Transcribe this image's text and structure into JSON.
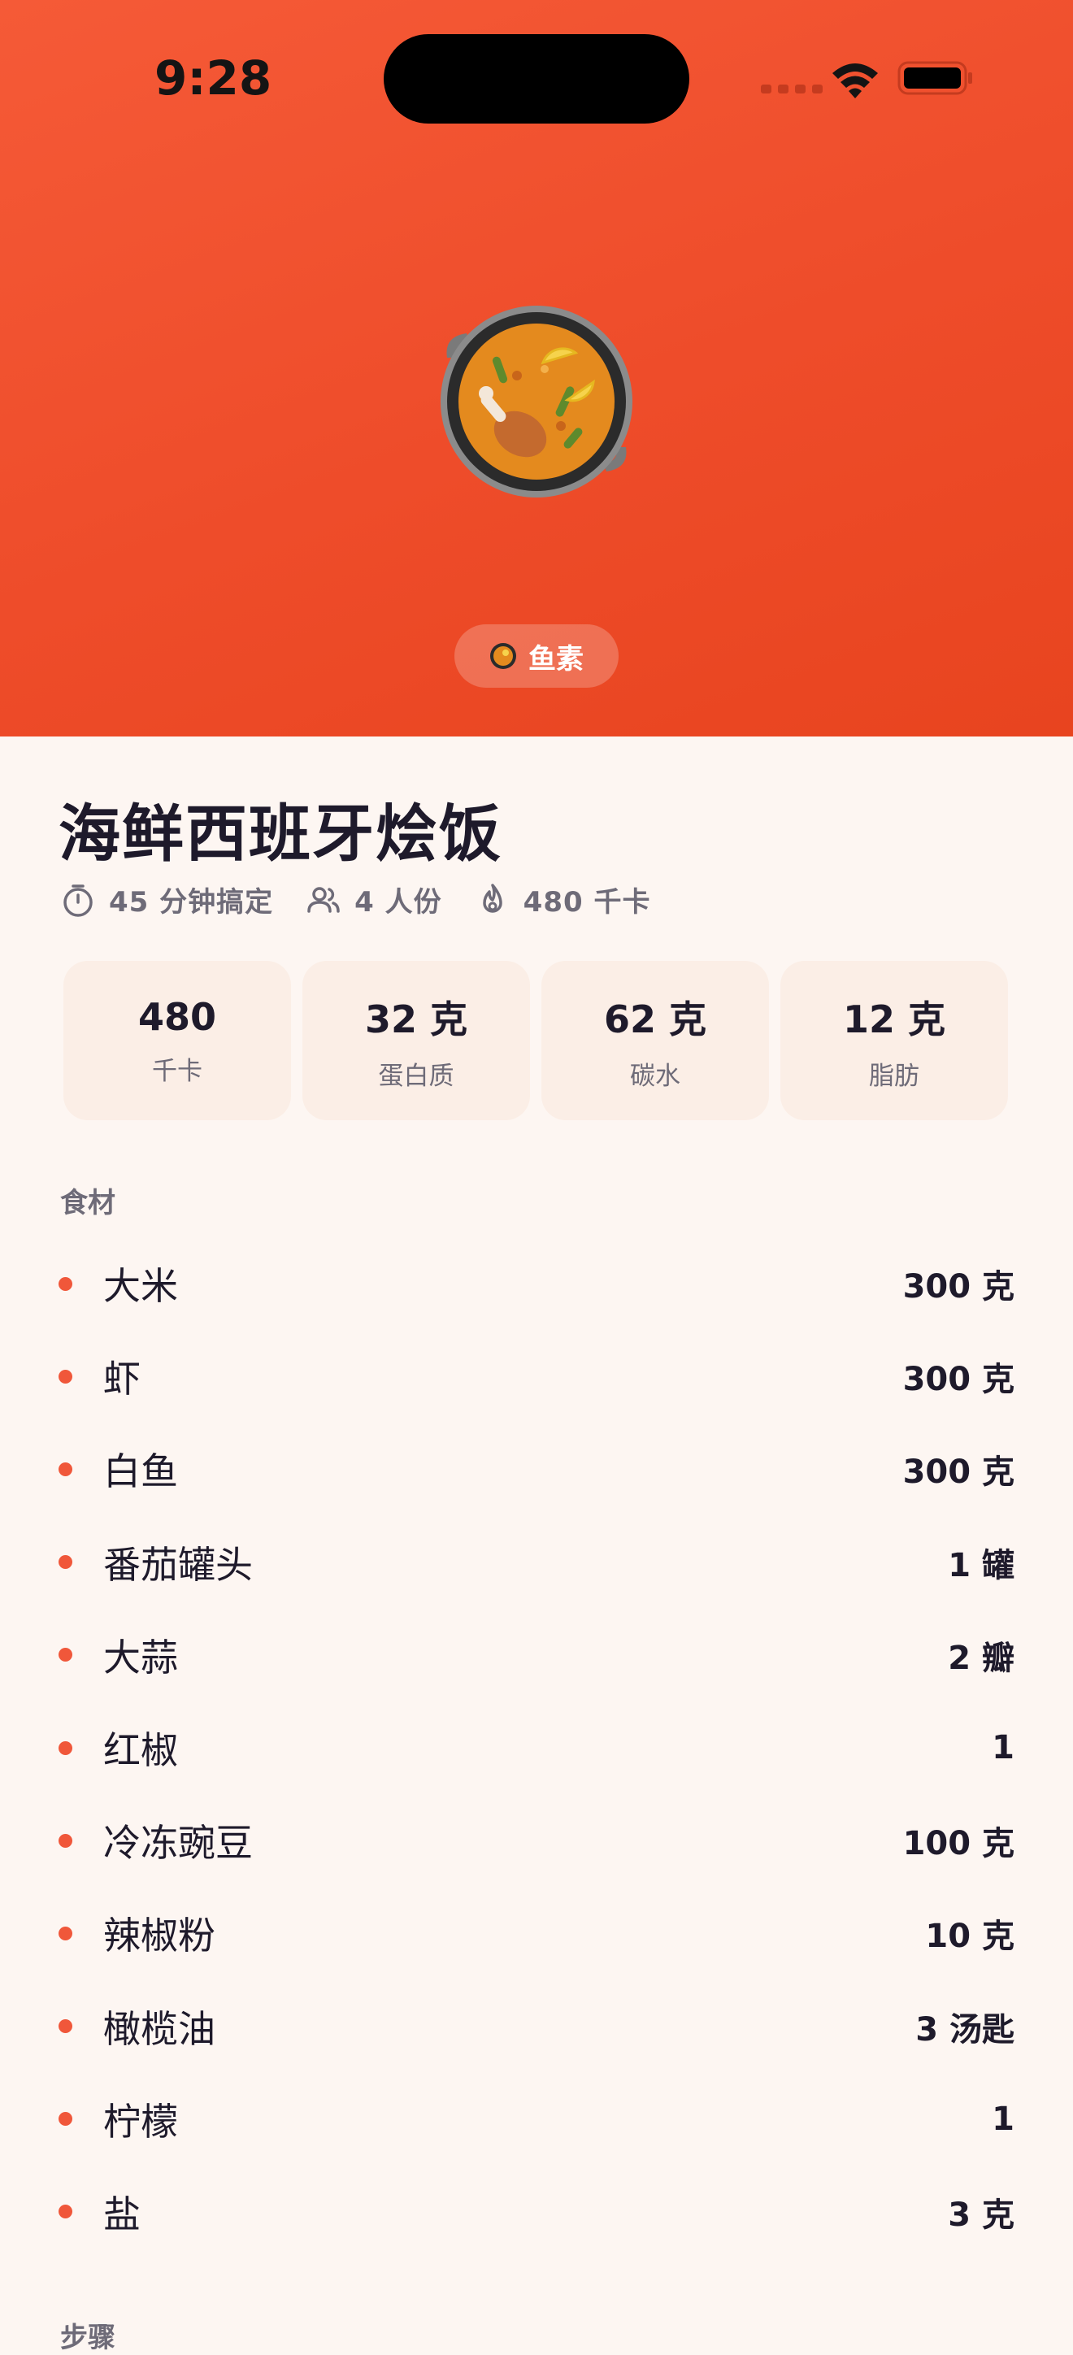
{
  "status_bar": {
    "time": "9:28"
  },
  "hero": {
    "dish_icon": "paella-emoji",
    "tag": {
      "icon": "paella-emoji",
      "label": "鱼素"
    },
    "colors": {
      "gradient_start": "#F55A37",
      "gradient_end": "#E8441F"
    }
  },
  "recipe": {
    "title": "海鲜西班牙烩饭",
    "meta": [
      {
        "icon": "timer-icon",
        "text": "45 分钟搞定"
      },
      {
        "icon": "people-icon",
        "text": "4 人份"
      },
      {
        "icon": "flame-icon",
        "text": "480 千卡"
      }
    ],
    "nutrition": [
      {
        "value": "480",
        "label": "千卡"
      },
      {
        "value": "32 克",
        "label": "蛋白质"
      },
      {
        "value": "62 克",
        "label": "碳水"
      },
      {
        "value": "12 克",
        "label": "脂肪"
      }
    ],
    "ingredients_heading": "食材",
    "ingredients": [
      {
        "name": "大米",
        "qty": "300 克"
      },
      {
        "name": "虾",
        "qty": "300 克"
      },
      {
        "name": "白鱼",
        "qty": "300 克"
      },
      {
        "name": "番茄罐头",
        "qty": "1 罐"
      },
      {
        "name": "大蒜",
        "qty": "2 瓣"
      },
      {
        "name": "红椒",
        "qty": "1"
      },
      {
        "name": "冷冻豌豆",
        "qty": "100 克"
      },
      {
        "name": "辣椒粉",
        "qty": "10 克"
      },
      {
        "name": "橄榄油",
        "qty": "3 汤匙"
      },
      {
        "name": "柠檬",
        "qty": "1"
      },
      {
        "name": "盐",
        "qty": "3 克"
      }
    ],
    "steps_heading": "步骤"
  },
  "colors": {
    "accent": "#F0573A",
    "text": "#1E1A2B",
    "muted": "#6E6B78",
    "card_bg": "#FBEEE6",
    "page_bg": "#FDF6F2"
  }
}
